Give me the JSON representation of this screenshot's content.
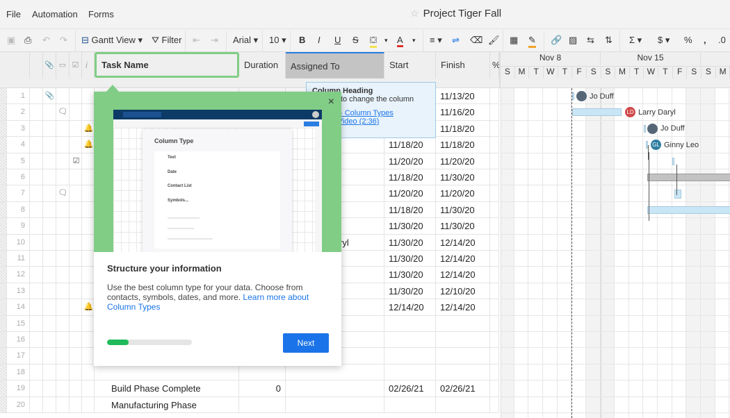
{
  "menu": {
    "items": [
      "File",
      "Automation",
      "Forms"
    ],
    "title": "Project Tiger Fall"
  },
  "toolbar": {
    "view": "Gantt View",
    "filter": "Filter",
    "font": "Arial",
    "size": "10",
    "bold": "B",
    "italic": "I",
    "underline": "U",
    "strike": "S",
    "text_color": "A",
    "sum": "Σ",
    "currency": "$",
    "percent": "%",
    "comma": ",",
    "decimal": ".0"
  },
  "columns": {
    "task_name": "Task Name",
    "duration": "Duration",
    "assigned_to": "Assigned To",
    "start": "Start",
    "finish": "Finish",
    "percent": "%",
    "info": "i"
  },
  "gantt": {
    "weeks": [
      "Nov 8",
      "Nov 15"
    ],
    "days": [
      "S",
      "M",
      "T",
      "W",
      "T",
      "F",
      "S",
      "S",
      "M",
      "T",
      "W",
      "T",
      "F",
      "S",
      "S",
      "M"
    ],
    "assignees": [
      {
        "row": 1,
        "name": "Jo Duff",
        "initials": "",
        "color": "#556677"
      },
      {
        "row": 2,
        "name": "Larry Daryl",
        "initials": "LD",
        "color": "#d04848"
      },
      {
        "row": 3,
        "name": "Jo Duff",
        "initials": "",
        "color": "#556677"
      },
      {
        "row": 4,
        "name": "Ginny Leo",
        "initials": "GL",
        "color": "#2f7ea0"
      }
    ]
  },
  "rows": [
    {
      "n": "1",
      "icon": "attachment",
      "task": "",
      "dur": "",
      "assigned": "",
      "start": "",
      "finish": "11/13/20"
    },
    {
      "n": "2",
      "icon": "comment",
      "task": "",
      "dur": "",
      "assigned": "",
      "start": "",
      "finish": "11/16/20"
    },
    {
      "n": "3",
      "icon": "reminder",
      "task": "",
      "dur": "",
      "assigned": "",
      "start": "",
      "finish": "11/18/20"
    },
    {
      "n": "4",
      "icon": "reminder",
      "task": "",
      "dur": "",
      "assigned": "o",
      "start": "11/18/20",
      "finish": "11/18/20"
    },
    {
      "n": "5",
      "icon": "proof",
      "task": "",
      "dur": "",
      "assigned": "",
      "start": "11/20/20",
      "finish": "11/20/20"
    },
    {
      "n": "6",
      "icon": "",
      "task": "",
      "dur": "",
      "assigned": "o",
      "start": "11/18/20",
      "finish": "11/30/20"
    },
    {
      "n": "7",
      "icon": "comment",
      "task": "",
      "dur": "",
      "assigned": "",
      "start": "11/20/20",
      "finish": "11/20/20"
    },
    {
      "n": "8",
      "icon": "",
      "task": "",
      "dur": "",
      "assigned": "",
      "start": "11/18/20",
      "finish": "11/30/20"
    },
    {
      "n": "9",
      "icon": "",
      "task": "",
      "dur": "",
      "assigned": "o",
      "start": "11/30/20",
      "finish": "11/30/20"
    },
    {
      "n": "10",
      "icon": "",
      "task": "",
      "dur": "",
      "assigned": "ryl",
      "start": "11/30/20",
      "finish": "12/14/20"
    },
    {
      "n": "11",
      "icon": "",
      "task": "",
      "dur": "",
      "assigned": "",
      "start": "11/30/20",
      "finish": "12/14/20"
    },
    {
      "n": "12",
      "icon": "",
      "task": "",
      "dur": "",
      "assigned": "",
      "start": "11/30/20",
      "finish": "12/14/20"
    },
    {
      "n": "13",
      "icon": "",
      "task": "",
      "dur": "",
      "assigned": "",
      "start": "11/30/20",
      "finish": "12/10/20"
    },
    {
      "n": "14",
      "icon": "reminder",
      "task": "",
      "dur": "",
      "assigned": "",
      "start": "12/14/20",
      "finish": "12/14/20"
    },
    {
      "n": "15",
      "icon": "",
      "task": "",
      "dur": "",
      "assigned": "",
      "start": "",
      "finish": ""
    },
    {
      "n": "16",
      "icon": "",
      "task": "",
      "dur": "",
      "assigned": "",
      "start": "",
      "finish": ""
    },
    {
      "n": "17",
      "icon": "",
      "task": "",
      "dur": "",
      "assigned": "",
      "start": "",
      "finish": ""
    },
    {
      "n": "18",
      "icon": "",
      "task": "",
      "dur": "",
      "assigned": "",
      "start": "",
      "finish": ""
    },
    {
      "n": "19",
      "icon": "",
      "task": "Build Phase Complete",
      "dur": "0",
      "assigned": "",
      "start": "02/26/21",
      "finish": "02/26/21"
    },
    {
      "n": "20",
      "icon": "",
      "task": "Manufacturing Phase",
      "dur": "",
      "assigned": "",
      "start": "",
      "finish": ""
    }
  ],
  "tooltip": {
    "title": "Column Heading",
    "text": "lick to change the column",
    "link1": "- Column Types",
    "link2": "ch Video (2:36)"
  },
  "popup": {
    "card_title": "Column Type",
    "card_items": [
      "Text",
      "Date",
      "Contact List",
      "Symbols..."
    ],
    "title": "Structure your information",
    "body": "Use the best column type for your data. Choose from contacts, symbols, dates, and more. ",
    "link": "Learn more about Column Types",
    "next": "Next",
    "close": "×",
    "progress": 0.25,
    "accent": "#81cd86"
  }
}
